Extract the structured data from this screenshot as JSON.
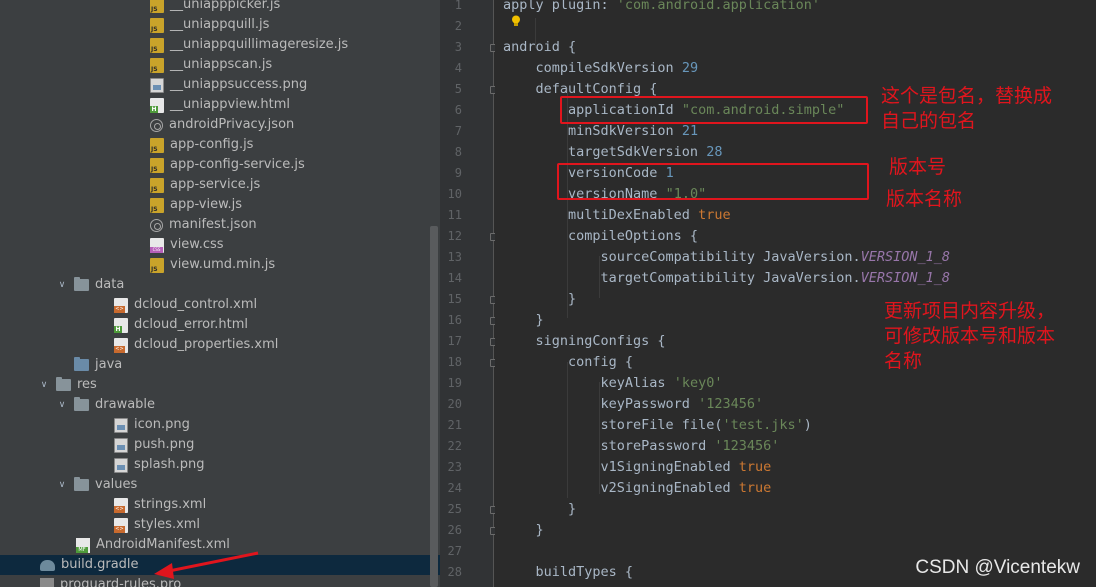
{
  "tree": {
    "rows": [
      {
        "label": "__uniapppicker.js",
        "icon": "js-file-icon"
      },
      {
        "label": "__uniappquill.js",
        "icon": "js-file-icon"
      },
      {
        "label": "__uniappquillimageresize.js",
        "icon": "js-file-icon"
      },
      {
        "label": "__uniappscan.js",
        "icon": "js-file-icon"
      },
      {
        "label": "__uniappsuccess.png",
        "icon": "image-file-icon"
      },
      {
        "label": "__uniappview.html",
        "icon": "html-file-icon"
      },
      {
        "label": "androidPrivacy.json",
        "icon": "json-file-icon"
      },
      {
        "label": "app-config.js",
        "icon": "js-file-icon"
      },
      {
        "label": "app-config-service.js",
        "icon": "js-file-icon"
      },
      {
        "label": "app-service.js",
        "icon": "js-file-icon"
      },
      {
        "label": "app-view.js",
        "icon": "js-file-icon"
      },
      {
        "label": "manifest.json",
        "icon": "json-file-icon"
      },
      {
        "label": "view.css",
        "icon": "css-file-icon"
      },
      {
        "label": "view.umd.min.js",
        "icon": "js-file-icon"
      },
      {
        "label": "data",
        "icon": "folder-icon",
        "expanded": true
      },
      {
        "label": "dcloud_control.xml",
        "icon": "xml-file-icon"
      },
      {
        "label": "dcloud_error.html",
        "icon": "html-file-icon"
      },
      {
        "label": "dcloud_properties.xml",
        "icon": "xml-file-icon"
      },
      {
        "label": "java",
        "icon": "source-folder-icon"
      },
      {
        "label": "res",
        "icon": "folder-icon",
        "expanded": true
      },
      {
        "label": "drawable",
        "icon": "folder-icon",
        "expanded": true
      },
      {
        "label": "icon.png",
        "icon": "image-file-icon"
      },
      {
        "label": "push.png",
        "icon": "image-file-icon"
      },
      {
        "label": "splash.png",
        "icon": "image-file-icon"
      },
      {
        "label": "values",
        "icon": "folder-icon",
        "expanded": true
      },
      {
        "label": "strings.xml",
        "icon": "xml-file-icon"
      },
      {
        "label": "styles.xml",
        "icon": "xml-file-icon"
      },
      {
        "label": "AndroidManifest.xml",
        "icon": "manifest-file-icon"
      },
      {
        "label": "build.gradle",
        "icon": "gradle-file-icon",
        "selected": true
      },
      {
        "label": "proguard-rules.pro",
        "icon": "pro-file-icon"
      }
    ]
  },
  "editor": {
    "line_numbers": [
      "1",
      "2",
      "3",
      "4",
      "5",
      "6",
      "7",
      "8",
      "9",
      "10",
      "11",
      "12",
      "13",
      "14",
      "15",
      "16",
      "17",
      "18",
      "19",
      "20",
      "21",
      "22",
      "23",
      "24",
      "25",
      "26",
      "27",
      "28"
    ],
    "lines": [
      [
        {
          "t": "apply",
          "c": "ident"
        },
        {
          "t": " plugin: ",
          "c": "ident"
        },
        {
          "t": "'com.android.application'",
          "c": "str"
        }
      ],
      [],
      [
        {
          "t": "android {",
          "c": "ident"
        }
      ],
      [
        {
          "t": "    compileSdkVersion ",
          "c": "ident"
        },
        {
          "t": "29",
          "c": "num"
        }
      ],
      [
        {
          "t": "    defaultConfig {",
          "c": "ident"
        }
      ],
      [
        {
          "t": "        applicationId ",
          "c": "ident"
        },
        {
          "t": "\"com.android.simple\"",
          "c": "str"
        }
      ],
      [
        {
          "t": "        minSdkVersion ",
          "c": "ident"
        },
        {
          "t": "21",
          "c": "num"
        }
      ],
      [
        {
          "t": "        targetSdkVersion ",
          "c": "ident"
        },
        {
          "t": "28",
          "c": "num"
        }
      ],
      [
        {
          "t": "        versionCode ",
          "c": "ident"
        },
        {
          "t": "1",
          "c": "num"
        }
      ],
      [
        {
          "t": "        versionName ",
          "c": "ident"
        },
        {
          "t": "\"1.0\"",
          "c": "str"
        }
      ],
      [
        {
          "t": "        multiDexEnabled ",
          "c": "ident"
        },
        {
          "t": "true",
          "c": "kw"
        }
      ],
      [
        {
          "t": "        compileOptions {",
          "c": "ident"
        }
      ],
      [
        {
          "t": "            sourceCompatibility JavaVersion.",
          "c": "ident"
        },
        {
          "t": "VERSION_1_8",
          "c": "const"
        }
      ],
      [
        {
          "t": "            targetCompatibility JavaVersion.",
          "c": "ident"
        },
        {
          "t": "VERSION_1_8",
          "c": "const"
        }
      ],
      [
        {
          "t": "        }",
          "c": "ident"
        }
      ],
      [
        {
          "t": "    }",
          "c": "ident"
        }
      ],
      [
        {
          "t": "    signingConfigs {",
          "c": "ident"
        }
      ],
      [
        {
          "t": "        config {",
          "c": "ident"
        }
      ],
      [
        {
          "t": "            keyAlias ",
          "c": "ident"
        },
        {
          "t": "'key0'",
          "c": "str"
        }
      ],
      [
        {
          "t": "            keyPassword ",
          "c": "ident"
        },
        {
          "t": "'123456'",
          "c": "str"
        }
      ],
      [
        {
          "t": "            storeFile file(",
          "c": "ident"
        },
        {
          "t": "'test.jks'",
          "c": "str"
        },
        {
          "t": ")",
          "c": "ident"
        }
      ],
      [
        {
          "t": "            storePassword ",
          "c": "ident"
        },
        {
          "t": "'123456'",
          "c": "str"
        }
      ],
      [
        {
          "t": "            v1SigningEnabled ",
          "c": "ident"
        },
        {
          "t": "true",
          "c": "kw"
        }
      ],
      [
        {
          "t": "            v2SigningEnabled ",
          "c": "ident"
        },
        {
          "t": "true",
          "c": "kw"
        }
      ],
      [
        {
          "t": "        }",
          "c": "ident"
        }
      ],
      [
        {
          "t": "    }",
          "c": "ident"
        }
      ],
      [],
      [
        {
          "t": "    buildTypes {",
          "c": "ident"
        }
      ]
    ]
  },
  "annotations": {
    "package_note": "这个是包名，替换成\n自己的包名",
    "version_code_note": "版本号",
    "version_name_note": "版本名称",
    "upgrade_note": "更新项目内容升级，\n可修改版本号和版本\n名称"
  },
  "watermark": "CSDN @Vicentekw",
  "colors": {
    "annotation_red": "#e0151d",
    "string_green": "#6a8759",
    "number_blue": "#6897bb",
    "keyword_orange": "#cc7832",
    "constant_purple": "#9876aa"
  }
}
